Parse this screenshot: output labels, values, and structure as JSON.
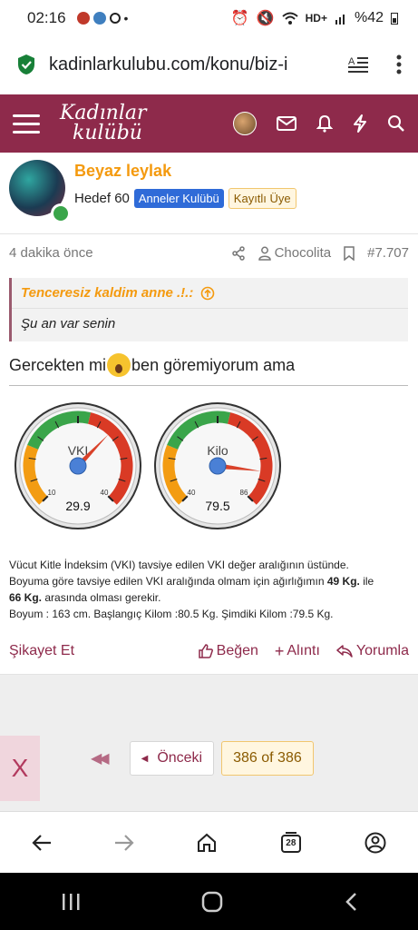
{
  "status": {
    "time": "02:16",
    "dot": "•",
    "battery": "%42",
    "icons": [
      "alarm-icon",
      "mute-icon",
      "wifi-icon",
      "hd-icon",
      "signal-icon",
      "battery-icon"
    ]
  },
  "browser": {
    "url": "kadinlarkulubu.com/konu/biz-i"
  },
  "site": {
    "logo_line1": "Kadınlar",
    "logo_line2": "kulübü",
    "brand_color": "#8e2a4b"
  },
  "post": {
    "author": "Beyaz leylak",
    "goal": "Hedef 60",
    "badge_group": "Anneler Kulübü",
    "badge_member": "Kayıtlı Üye",
    "time_ago": "4 dakika önce",
    "quoted_user": "Chocolita",
    "post_number": "#7.707",
    "quote_head": "Tenceresiz kaldim anne .!.:",
    "quote_body": "Şu an var senin",
    "text_before": "Gercekten mi",
    "text_after": "ben göremiyorum ama",
    "bmi_line1": "Vücut Kitle İndeksim (VKI) tavsiye edilen VKI değer aralığının üstünde.",
    "bmi_line2_a": "Boyuma göre tavsiye edilen VKI aralığında olmam için ağırlığımın ",
    "bmi_line2_b": "49 Kg.",
    "bmi_line2_c": " ile",
    "bmi_line3_a": "66 Kg.",
    "bmi_line3_b": " arasında olması gerekir.",
    "bmi_line4": "Boyum : 163 cm. Başlangıç Kilom :80.5 Kg. Şimdiki Kilom :79.5 Kg."
  },
  "gauges": [
    {
      "label": "VKI",
      "min_label": "10",
      "max_label": "40",
      "value_label": "29.9",
      "min": 10,
      "max": 40,
      "value": 29.9
    },
    {
      "label": "Kilo",
      "min_label": "40",
      "max_label": "86",
      "value_label": "79.5",
      "min": 40,
      "max": 86,
      "value": 79.5
    }
  ],
  "actions": {
    "report": "Şikayet Et",
    "like": "Beğen",
    "quote": "Alıntı",
    "reply": "Yorumla"
  },
  "pagination": {
    "prev": "Önceki",
    "page": "386 of 386"
  },
  "close_label": "X",
  "tab_count": "28"
}
